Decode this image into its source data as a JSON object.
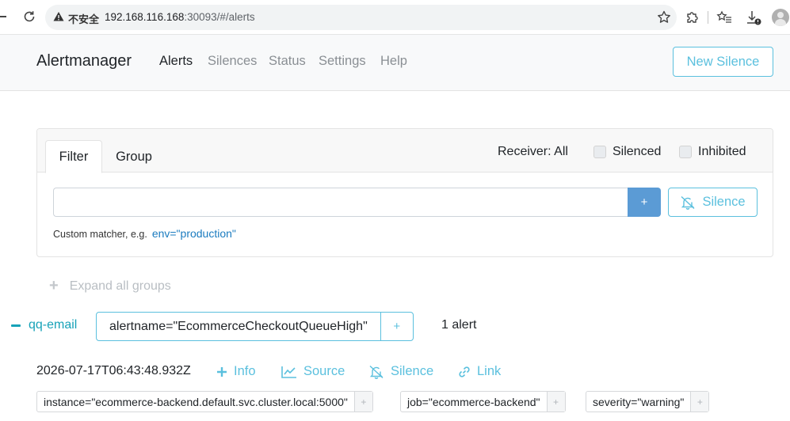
{
  "browser": {
    "insecure_label": "不安全",
    "url_host": "192.168.116.168",
    "url_path": ":30093/#/alerts"
  },
  "navbar": {
    "brand": "Alertmanager",
    "links": [
      "Alerts",
      "Silences",
      "Status",
      "Settings",
      "Help"
    ],
    "active_link": "Alerts",
    "new_silence_label": "New Silence"
  },
  "filter": {
    "tabs": [
      "Filter",
      "Group"
    ],
    "active_tab": "Filter",
    "receiver_label": "Receiver: All",
    "silenced_label": "Silenced",
    "inhibited_label": "Inhibited",
    "input_value": "",
    "add_button_label": "+",
    "silence_button_label": "Silence",
    "hint_text": "Custom matcher, e.g.",
    "hint_example": "env=\"production\""
  },
  "expand_all_label": "Expand all groups",
  "group": {
    "receiver": "qq-email",
    "label": "alertname=\"EcommerceCheckoutQueueHigh\"",
    "label_add": "+",
    "count_text": "1 alert"
  },
  "alert": {
    "timestamp": "2026-07-17T06:43:48.932Z",
    "actions": {
      "info": "Info",
      "source": "Source",
      "silence": "Silence",
      "link": "Link"
    },
    "labels": [
      "instance=\"ecommerce-backend.default.svc.cluster.local:5000\"",
      "job=\"ecommerce-backend\"",
      "severity=\"warning\""
    ],
    "label_add": "+"
  },
  "colors": {
    "accent_info": "#5bc0de",
    "primary": "#5b9bd5",
    "teal": "#17a2b8"
  }
}
